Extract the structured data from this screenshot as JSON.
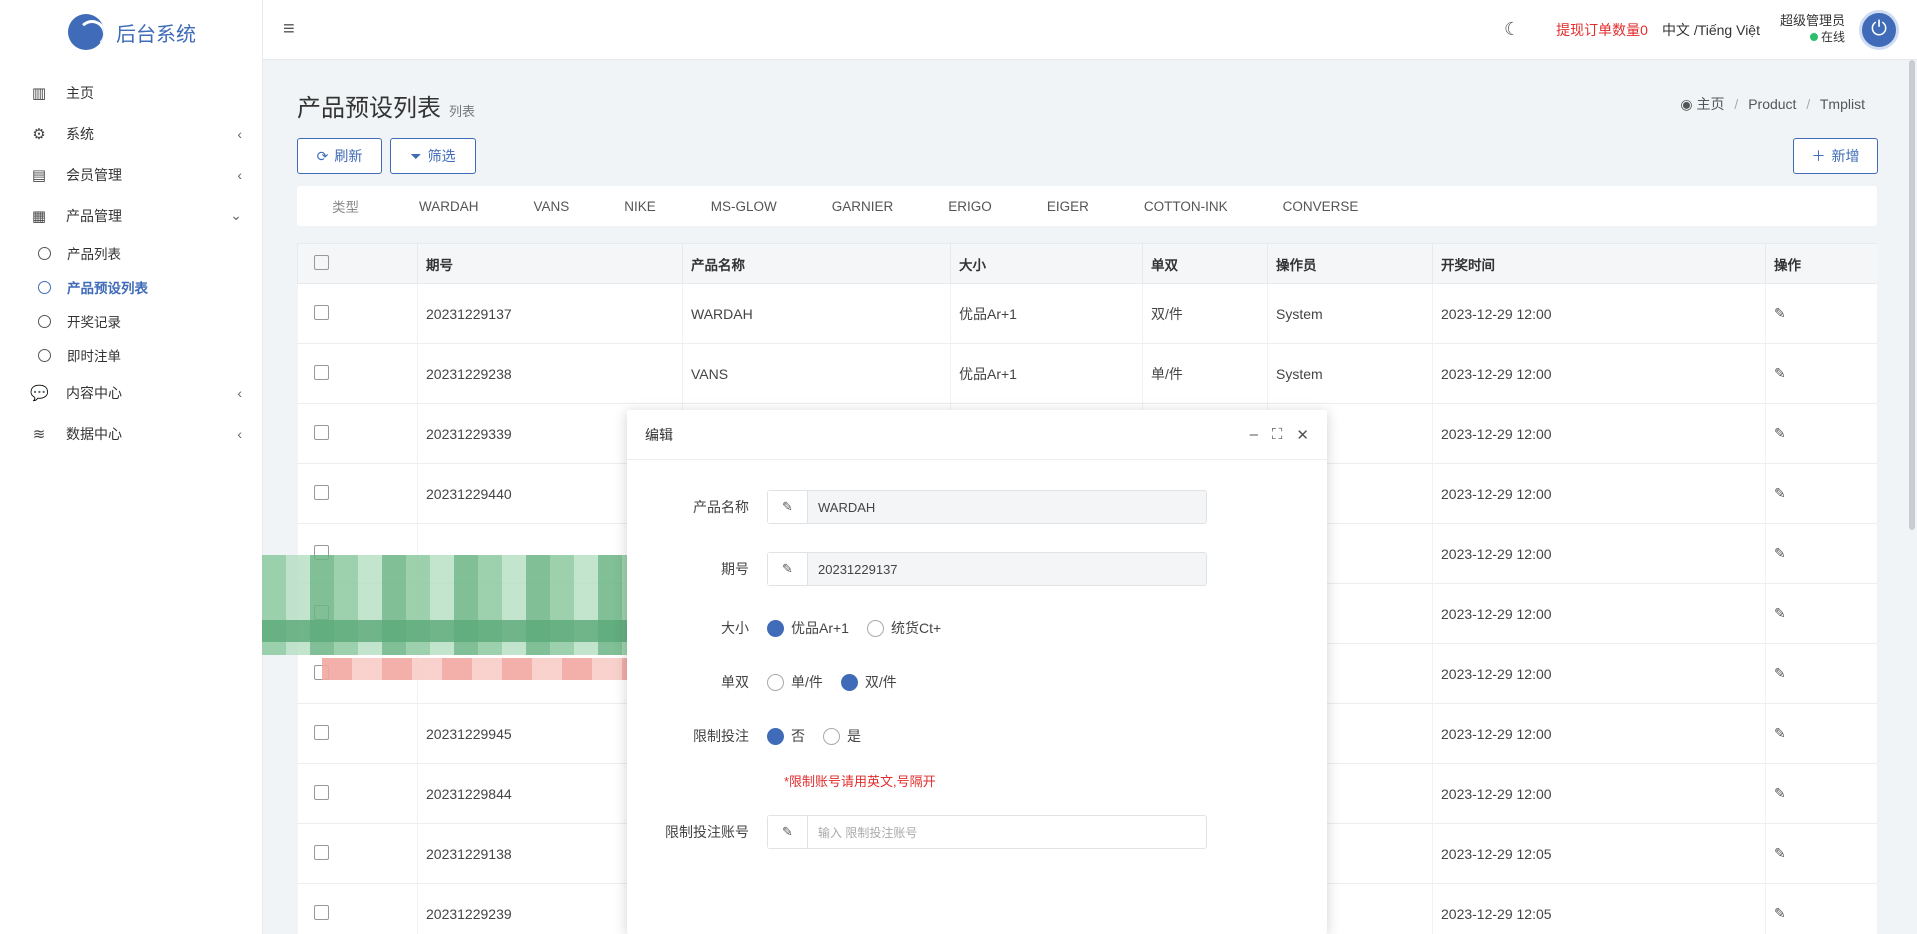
{
  "app": {
    "title": "后台系统"
  },
  "sidebar": {
    "items": [
      {
        "label": "主页",
        "icon": "chart-icon"
      },
      {
        "label": "系统",
        "icon": "gear-icon"
      },
      {
        "label": "会员管理",
        "icon": "id-card-icon"
      },
      {
        "label": "产品管理",
        "icon": "grid-icon"
      },
      {
        "label": "内容中心",
        "icon": "chat-icon"
      },
      {
        "label": "数据中心",
        "icon": "database-icon"
      }
    ],
    "sub_items": [
      {
        "label": "产品列表"
      },
      {
        "label": "产品预设列表"
      },
      {
        "label": "开奖记录"
      },
      {
        "label": "即时注单"
      }
    ]
  },
  "topbar": {
    "withdraw_label": "提现订单数量0",
    "lang_label": "中文 /Tiếng Việt",
    "admin_name": "超级管理员",
    "admin_status": "在线"
  },
  "page": {
    "title": "产品预设列表",
    "subtitle": "列表"
  },
  "breadcrumb": {
    "home": "主页",
    "level1": "Product",
    "level2": "Tmplist"
  },
  "toolbar": {
    "refresh": "刷新",
    "filter": "筛选",
    "add": "新增"
  },
  "filters": [
    "类型",
    "WARDAH",
    "VANS",
    "NIKE",
    "MS-GLOW",
    "GARNIER",
    "ERIGO",
    "EIGER",
    "COTTON-INK",
    "CONVERSE"
  ],
  "table": {
    "columns": [
      "期号",
      "产品名称",
      "大小",
      "单双",
      "操作员",
      "开奖时间",
      "操作"
    ],
    "rows": [
      {
        "issue": "20231229137",
        "product": "WARDAH",
        "size": "优品Ar+1",
        "odd_even": "双/件",
        "operator": "System",
        "time": "2023-12-29 12:00"
      },
      {
        "issue": "20231229238",
        "product": "VANS",
        "size": "优品Ar+1",
        "odd_even": "单/件",
        "operator": "System",
        "time": "2023-12-29 12:00"
      },
      {
        "issue": "20231229339",
        "product": "",
        "size": "",
        "odd_even": "",
        "operator": "",
        "time": "2023-12-29 12:00"
      },
      {
        "issue": "20231229440",
        "product": "",
        "size": "",
        "odd_even": "",
        "operator": "",
        "time": "2023-12-29 12:00"
      },
      {
        "issue": "",
        "product": "",
        "size": "",
        "odd_even": "",
        "operator": "",
        "time": "2023-12-29 12:00"
      },
      {
        "issue": "",
        "product": "",
        "size": "",
        "odd_even": "",
        "operator": "",
        "time": "2023-12-29 12:00"
      },
      {
        "issue": "",
        "product": "",
        "size": "",
        "odd_even": "",
        "operator": "",
        "time": "2023-12-29 12:00"
      },
      {
        "issue": "20231229945",
        "product": "",
        "size": "",
        "odd_even": "",
        "operator": "",
        "time": "2023-12-29 12:00"
      },
      {
        "issue": "20231229844",
        "product": "",
        "size": "",
        "odd_even": "",
        "operator": "",
        "time": "2023-12-29 12:00"
      },
      {
        "issue": "20231229138",
        "product": "",
        "size": "",
        "odd_even": "",
        "operator": "",
        "time": "2023-12-29 12:05"
      },
      {
        "issue": "20231229239",
        "product": "",
        "size": "",
        "odd_even": "",
        "operator": "",
        "time": "2023-12-29 12:05"
      }
    ]
  },
  "modal": {
    "title": "编辑",
    "fields": {
      "product_label": "产品名称",
      "product_value": "WARDAH",
      "issue_label": "期号",
      "issue_value": "20231229137",
      "size_label": "大小",
      "size_opt1": "优品Ar+1",
      "size_opt2": "统货Ct+",
      "oe_label": "单双",
      "oe_opt1": "单/件",
      "oe_opt2": "双/件",
      "limit_label": "限制投注",
      "limit_opt1": "否",
      "limit_opt2": "是",
      "hint": "*限制账号请用英文,号隔开",
      "account_label": "限制投注账号",
      "account_placeholder": "输入 限制投注账号"
    }
  },
  "colors": {
    "accent": "#3f6bb8",
    "danger": "#e02d2d",
    "online": "#2bbf6b"
  }
}
